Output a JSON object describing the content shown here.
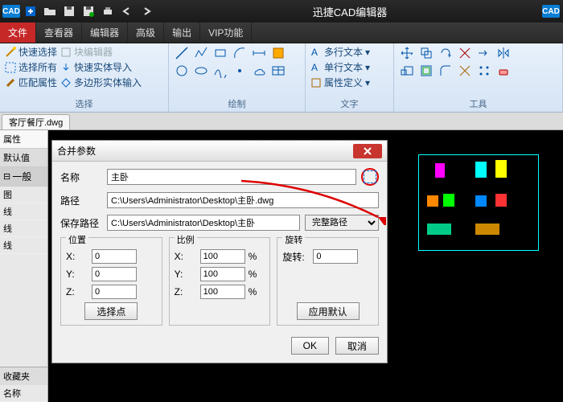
{
  "app": {
    "title": "迅捷CAD编辑器",
    "badge": "CAD"
  },
  "menus": {
    "file": "文件",
    "viewer": "查看器",
    "editor": "编辑器",
    "advanced": "高级",
    "output": "输出",
    "vip": "VIP功能"
  },
  "ribbon": {
    "select": {
      "quick_select": "快速选择",
      "block_editor": "块编辑器",
      "select_all": "选择所有",
      "quick_import": "快速实体导入",
      "match_prop": "匹配属性",
      "poly_import": "多边形实体输入",
      "label": "选择"
    },
    "draw_label": "绘制",
    "text": {
      "mtext": "多行文本",
      "stext": "单行文本",
      "attdef": "属性定义",
      "label": "文字"
    },
    "tools_label": "工具"
  },
  "doc": {
    "tab": "客厅餐厅.dwg"
  },
  "left": {
    "prop": "属性",
    "default": "默认值",
    "general": "一般",
    "fav": "收藏夹",
    "name": "名称",
    "r1": "图",
    "r2": "线",
    "r3": "线",
    "r4": "线"
  },
  "dialog": {
    "title": "合并参数",
    "name_lbl": "名称",
    "name_val": "主卧",
    "path_lbl": "路径",
    "path_val": "C:\\Users\\Administrator\\Desktop\\主卧.dwg",
    "save_lbl": "保存路径",
    "save_val": "C:\\Users\\Administrator\\Desktop\\主卧",
    "path_mode": "完整路径",
    "pos": {
      "t": "位置",
      "x": "X:",
      "y": "Y:",
      "z": "Z:",
      "xv": "0",
      "yv": "0",
      "zv": "0",
      "pick": "选择点"
    },
    "scale": {
      "t": "比例",
      "x": "X:",
      "y": "Y:",
      "z": "Z:",
      "xv": "100",
      "yv": "100",
      "zv": "100",
      "pct": "%"
    },
    "rot": {
      "t": "旋转",
      "lbl": "旋转:",
      "v": "0",
      "apply": "应用默认"
    },
    "ok": "OK",
    "cancel": "取消"
  }
}
